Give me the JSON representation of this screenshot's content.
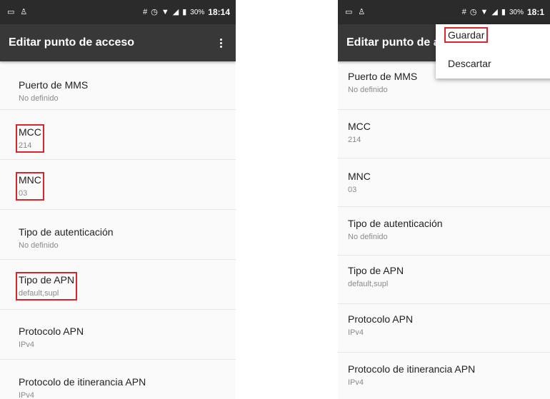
{
  "status_bar": {
    "left_icons": [
      "notification-icon",
      "android-icon"
    ],
    "right_icons": [
      "hash-icon",
      "alarm-icon",
      "wifi-icon",
      "signal-icon",
      "battery-icon"
    ],
    "battery": "30%",
    "time_left": "18:14",
    "time_right": "18:1"
  },
  "left_screen": {
    "title": "Editar punto de acceso",
    "items": [
      {
        "title": "Puerto de MMS",
        "summary": "No definido"
      },
      {
        "title": "MCC",
        "summary": "214"
      },
      {
        "title": "MNC",
        "summary": "03"
      },
      {
        "title": "Tipo de autenticación",
        "summary": "No definido"
      },
      {
        "title": "Tipo de APN",
        "summary": "default,supl"
      },
      {
        "title": "Protocolo APN",
        "summary": "IPv4"
      },
      {
        "title": "Protocolo de itinerancia APN",
        "summary": "IPv4"
      }
    ]
  },
  "right_screen": {
    "title": "Editar punto de a",
    "menu": {
      "save_label": "Guardar",
      "discard_label": "Descartar"
    },
    "items": [
      {
        "title": "Puerto de MMS",
        "summary": "No definido"
      },
      {
        "title": "MCC",
        "summary": "214"
      },
      {
        "title": "MNC",
        "summary": "03"
      },
      {
        "title": "Tipo de autenticación",
        "summary": "No definido"
      },
      {
        "title": "Tipo de APN",
        "summary": "default,supl"
      },
      {
        "title": "Protocolo APN",
        "summary": "IPv4"
      },
      {
        "title": "Protocolo de itinerancia APN",
        "summary": "IPv4"
      }
    ]
  },
  "colors": {
    "status_bar": "#2b2b2b",
    "app_bar": "#383838",
    "highlight": "#d7262c",
    "summary_text": "#8a8a8a"
  }
}
